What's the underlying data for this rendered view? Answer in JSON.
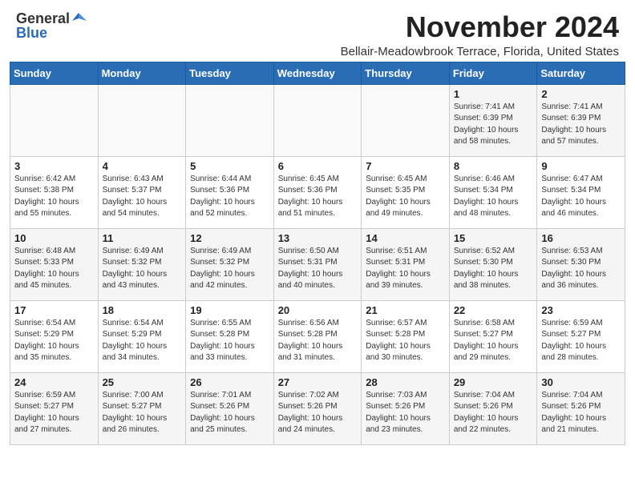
{
  "header": {
    "logo_line1": "General",
    "logo_line2": "Blue",
    "month": "November 2024",
    "location": "Bellair-Meadowbrook Terrace, Florida, United States"
  },
  "weekdays": [
    "Sunday",
    "Monday",
    "Tuesday",
    "Wednesday",
    "Thursday",
    "Friday",
    "Saturday"
  ],
  "weeks": [
    [
      {
        "day": "",
        "info": ""
      },
      {
        "day": "",
        "info": ""
      },
      {
        "day": "",
        "info": ""
      },
      {
        "day": "",
        "info": ""
      },
      {
        "day": "",
        "info": ""
      },
      {
        "day": "1",
        "info": "Sunrise: 7:41 AM\nSunset: 6:39 PM\nDaylight: 10 hours\nand 58 minutes."
      },
      {
        "day": "2",
        "info": "Sunrise: 7:41 AM\nSunset: 6:39 PM\nDaylight: 10 hours\nand 57 minutes."
      }
    ],
    [
      {
        "day": "3",
        "info": "Sunrise: 6:42 AM\nSunset: 5:38 PM\nDaylight: 10 hours\nand 55 minutes."
      },
      {
        "day": "4",
        "info": "Sunrise: 6:43 AM\nSunset: 5:37 PM\nDaylight: 10 hours\nand 54 minutes."
      },
      {
        "day": "5",
        "info": "Sunrise: 6:44 AM\nSunset: 5:36 PM\nDaylight: 10 hours\nand 52 minutes."
      },
      {
        "day": "6",
        "info": "Sunrise: 6:45 AM\nSunset: 5:36 PM\nDaylight: 10 hours\nand 51 minutes."
      },
      {
        "day": "7",
        "info": "Sunrise: 6:45 AM\nSunset: 5:35 PM\nDaylight: 10 hours\nand 49 minutes."
      },
      {
        "day": "8",
        "info": "Sunrise: 6:46 AM\nSunset: 5:34 PM\nDaylight: 10 hours\nand 48 minutes."
      },
      {
        "day": "9",
        "info": "Sunrise: 6:47 AM\nSunset: 5:34 PM\nDaylight: 10 hours\nand 46 minutes."
      }
    ],
    [
      {
        "day": "10",
        "info": "Sunrise: 6:48 AM\nSunset: 5:33 PM\nDaylight: 10 hours\nand 45 minutes."
      },
      {
        "day": "11",
        "info": "Sunrise: 6:49 AM\nSunset: 5:32 PM\nDaylight: 10 hours\nand 43 minutes."
      },
      {
        "day": "12",
        "info": "Sunrise: 6:49 AM\nSunset: 5:32 PM\nDaylight: 10 hours\nand 42 minutes."
      },
      {
        "day": "13",
        "info": "Sunrise: 6:50 AM\nSunset: 5:31 PM\nDaylight: 10 hours\nand 40 minutes."
      },
      {
        "day": "14",
        "info": "Sunrise: 6:51 AM\nSunset: 5:31 PM\nDaylight: 10 hours\nand 39 minutes."
      },
      {
        "day": "15",
        "info": "Sunrise: 6:52 AM\nSunset: 5:30 PM\nDaylight: 10 hours\nand 38 minutes."
      },
      {
        "day": "16",
        "info": "Sunrise: 6:53 AM\nSunset: 5:30 PM\nDaylight: 10 hours\nand 36 minutes."
      }
    ],
    [
      {
        "day": "17",
        "info": "Sunrise: 6:54 AM\nSunset: 5:29 PM\nDaylight: 10 hours\nand 35 minutes."
      },
      {
        "day": "18",
        "info": "Sunrise: 6:54 AM\nSunset: 5:29 PM\nDaylight: 10 hours\nand 34 minutes."
      },
      {
        "day": "19",
        "info": "Sunrise: 6:55 AM\nSunset: 5:28 PM\nDaylight: 10 hours\nand 33 minutes."
      },
      {
        "day": "20",
        "info": "Sunrise: 6:56 AM\nSunset: 5:28 PM\nDaylight: 10 hours\nand 31 minutes."
      },
      {
        "day": "21",
        "info": "Sunrise: 6:57 AM\nSunset: 5:28 PM\nDaylight: 10 hours\nand 30 minutes."
      },
      {
        "day": "22",
        "info": "Sunrise: 6:58 AM\nSunset: 5:27 PM\nDaylight: 10 hours\nand 29 minutes."
      },
      {
        "day": "23",
        "info": "Sunrise: 6:59 AM\nSunset: 5:27 PM\nDaylight: 10 hours\nand 28 minutes."
      }
    ],
    [
      {
        "day": "24",
        "info": "Sunrise: 6:59 AM\nSunset: 5:27 PM\nDaylight: 10 hours\nand 27 minutes."
      },
      {
        "day": "25",
        "info": "Sunrise: 7:00 AM\nSunset: 5:27 PM\nDaylight: 10 hours\nand 26 minutes."
      },
      {
        "day": "26",
        "info": "Sunrise: 7:01 AM\nSunset: 5:26 PM\nDaylight: 10 hours\nand 25 minutes."
      },
      {
        "day": "27",
        "info": "Sunrise: 7:02 AM\nSunset: 5:26 PM\nDaylight: 10 hours\nand 24 minutes."
      },
      {
        "day": "28",
        "info": "Sunrise: 7:03 AM\nSunset: 5:26 PM\nDaylight: 10 hours\nand 23 minutes."
      },
      {
        "day": "29",
        "info": "Sunrise: 7:04 AM\nSunset: 5:26 PM\nDaylight: 10 hours\nand 22 minutes."
      },
      {
        "day": "30",
        "info": "Sunrise: 7:04 AM\nSunset: 5:26 PM\nDaylight: 10 hours\nand 21 minutes."
      }
    ]
  ]
}
